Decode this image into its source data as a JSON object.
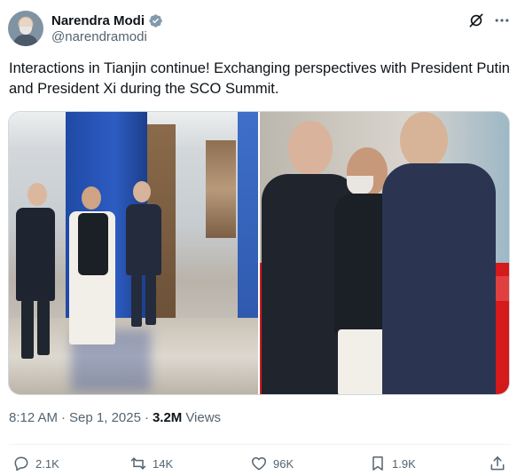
{
  "author": {
    "display_name": "Narendra Modi",
    "handle": "@narendramodi",
    "verified": true
  },
  "tweet": {
    "text": "Interactions in Tianjin continue! Exchanging perspectives with President Putin and President Xi during the SCO Summit."
  },
  "meta": {
    "time": "8:12 AM",
    "separator": "·",
    "date": "Sep 1, 2025",
    "views_count": "3.2M",
    "views_label": "Views"
  },
  "actions": {
    "replies": "2.1K",
    "reposts": "14K",
    "likes": "96K",
    "bookmarks": "1.9K"
  },
  "icons": {
    "verified": "verified-badge-icon",
    "grok": "grok-icon",
    "more": "more-icon",
    "reply": "reply-icon",
    "repost": "repost-icon",
    "like": "heart-icon",
    "bookmark": "bookmark-icon",
    "share": "share-icon"
  },
  "colors": {
    "text_primary": "#0f1419",
    "text_secondary": "#536471",
    "verified": "#829aab",
    "divider": "#eff3f4"
  }
}
